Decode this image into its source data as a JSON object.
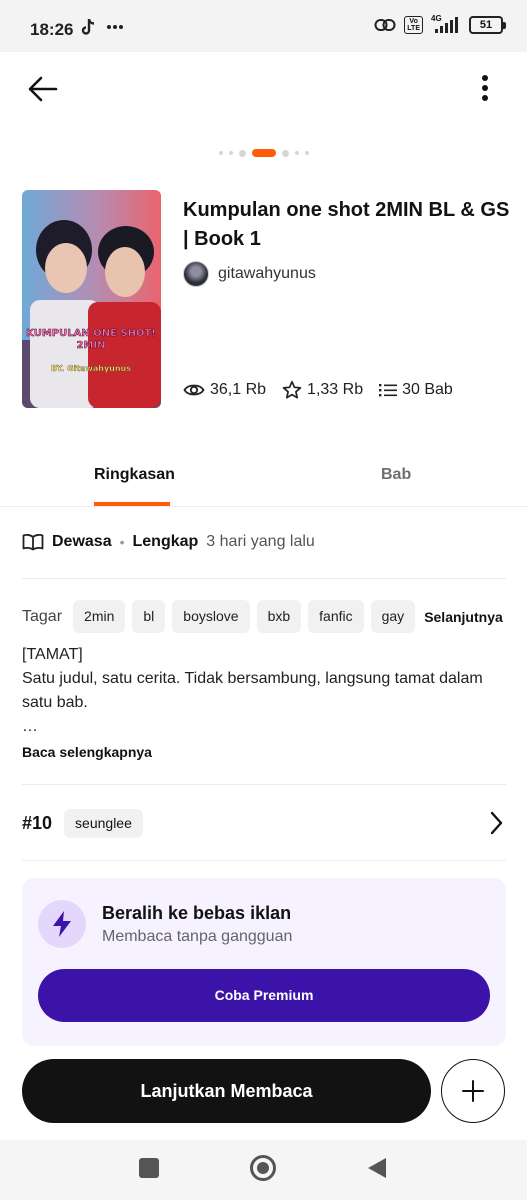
{
  "status_bar": {
    "time": "18:26",
    "battery": "51",
    "network": "4G",
    "volte_top": "Vo",
    "volte_bottom": "LTE"
  },
  "story": {
    "title": "Kumpulan one shot 2MIN BL & GS | Book 1",
    "author": "gitawahyunus",
    "cover_text_line1": "KUMPULAN ONE SHOT!",
    "cover_text_line2": "2MIN",
    "cover_text_line3": "BY. Gitawahyunus",
    "reads": "36,1 Rb",
    "votes": "1,33 Rb",
    "parts": "30 Bab"
  },
  "tabs": [
    {
      "label": "Ringkasan",
      "active": true
    },
    {
      "label": "Bab",
      "active": false
    }
  ],
  "meta": {
    "rating": "Dewasa",
    "separator": "•",
    "status": "Lengkap",
    "updated": "3 hari yang lalu"
  },
  "tags": {
    "label": "Tagar",
    "items": [
      "2min",
      "bl",
      "boyslove",
      "bxb",
      "fanfic",
      "gay"
    ],
    "more": "Selanjutnya"
  },
  "description": {
    "line1": "[TAMAT]",
    "line2": "Satu judul, satu cerita. Tidak bersambung, langsung tamat dalam satu bab.",
    "ellipsis": "…",
    "read_more": "Baca selengkapnya"
  },
  "ranking": {
    "rank": "#10",
    "tag": "seunglee"
  },
  "premium": {
    "title": "Beralih ke bebas iklan",
    "subtitle": "Membaca tanpa gangguan",
    "button": "Coba Premium"
  },
  "actions": {
    "continue": "Lanjutkan Membaca"
  },
  "colors": {
    "accent": "#ff5c0a",
    "premium_button": "#3b13a8",
    "premium_bg": "#f6f2ff",
    "cta": "#121212"
  },
  "icons": [
    "arrow-left-icon",
    "more-vertical-icon",
    "eye-icon",
    "star-icon",
    "list-icon",
    "book-open-icon",
    "chevron-right-icon",
    "bolt-icon",
    "plus-icon",
    "tiktok-icon",
    "link-icon",
    "signal-icon"
  ]
}
